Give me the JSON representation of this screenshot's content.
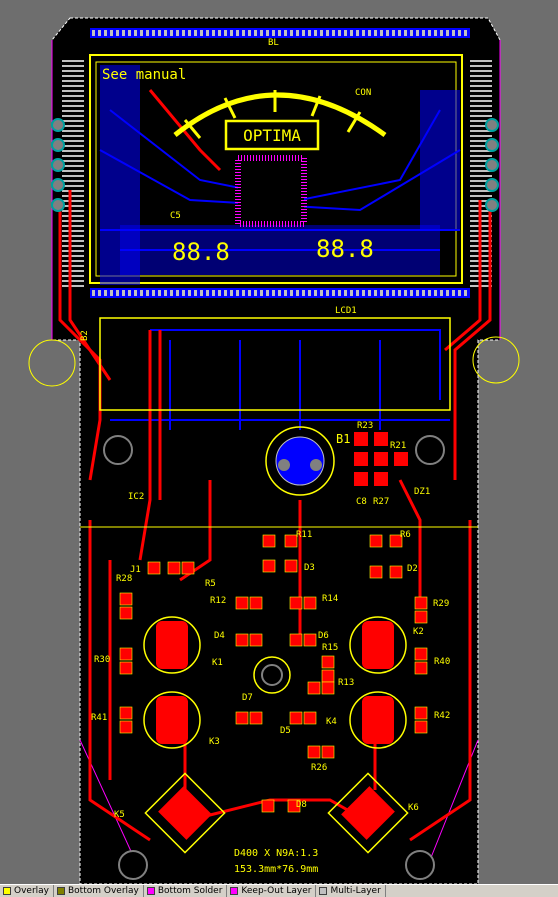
{
  "colors": {
    "canvas_bg": "#6e6e6e",
    "board_fill": "#000000",
    "top_layer": "#ff0000",
    "bottom_layer": "#0000ff",
    "top_overlay": "#ffff00",
    "keep_out": "#ff00ff",
    "multi_layer": "#c0c0c0"
  },
  "silkscreen": {
    "see_manual": "See manual",
    "optima": "OPTIMA",
    "lcd_left_digits": "88.8",
    "lcd_right_digits": "88.8",
    "lcd_label": "LCD1",
    "b1_label": "B1",
    "bl_label": "BL",
    "b2_label": "B2",
    "footer_line1": "D400 X N9A:1.3",
    "footer_line2": "153.3mm*76.9mm",
    "con_label": "CON"
  },
  "designators": {
    "r21": "R21",
    "r23": "R23",
    "c8": "C8",
    "r27": "R27",
    "dz1": "DZ1",
    "r11": "R11",
    "r6": "R6",
    "j1": "J1",
    "r5": "R5",
    "d3": "D3",
    "d2": "D2",
    "r28": "R28",
    "r12": "R12",
    "r14": "R14",
    "r29": "R29",
    "d4": "D4",
    "d6": "D6",
    "r15": "R15",
    "k1": "K1",
    "k2": "K2",
    "r30": "R30",
    "r40": "R40",
    "r13": "R13",
    "d7": "D7",
    "d5": "D5",
    "k4": "K4",
    "r41": "R41",
    "r42": "R42",
    "k3": "K3",
    "r26": "R26",
    "k5": "K5",
    "d8": "D8",
    "k6": "K6",
    "ic2": "IC2",
    "c5": "C5"
  },
  "layer_tabs": [
    {
      "label": "Overlay",
      "color": "#ffff00"
    },
    {
      "label": "Bottom Overlay",
      "color": "#808000"
    },
    {
      "label": "Bottom Solder",
      "color": "#ff00ff"
    },
    {
      "label": "Keep-Out Layer",
      "color": "#ff00ff"
    },
    {
      "label": "Multi-Layer",
      "color": "#c0c0c0"
    }
  ]
}
